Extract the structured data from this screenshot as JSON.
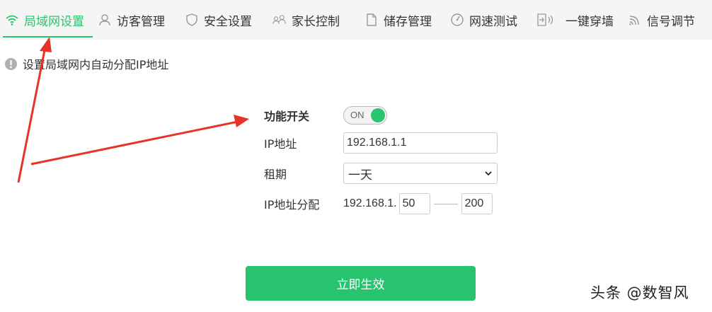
{
  "tabs": [
    {
      "label": "局域网设置",
      "icon": "wifi-icon",
      "active": true
    },
    {
      "label": "访客管理",
      "icon": "user-icon",
      "active": false
    },
    {
      "label": "安全设置",
      "icon": "shield-icon",
      "active": false
    },
    {
      "label": "家长控制",
      "icon": "family-icon",
      "active": false
    },
    {
      "label": "储存管理",
      "icon": "folder-icon",
      "active": false
    },
    {
      "label": "网速测试",
      "icon": "speedometer-icon",
      "active": false
    },
    {
      "label": "一键穿墙",
      "icon": "wall-signal-icon",
      "active": false
    },
    {
      "label": "信号调节",
      "icon": "signal-icon",
      "active": false
    }
  ],
  "hint": {
    "text": "设置局域网内自动分配IP地址",
    "icon": "info-icon"
  },
  "form": {
    "switch": {
      "label": "功能开关",
      "state": "ON"
    },
    "ip": {
      "label": "IP地址",
      "value": "192.168.1.1"
    },
    "lease": {
      "label": "租期",
      "value": "一天"
    },
    "pool": {
      "label": "IP地址分配",
      "prefix": "192.168.1.",
      "start": "50",
      "end": "200"
    }
  },
  "submit": {
    "label": "立即生效"
  },
  "watermark": {
    "text": "头条 @数智风"
  },
  "colors": {
    "accent": "#2bc46f",
    "button": "#27c36e",
    "annotation": "#e8322a"
  }
}
